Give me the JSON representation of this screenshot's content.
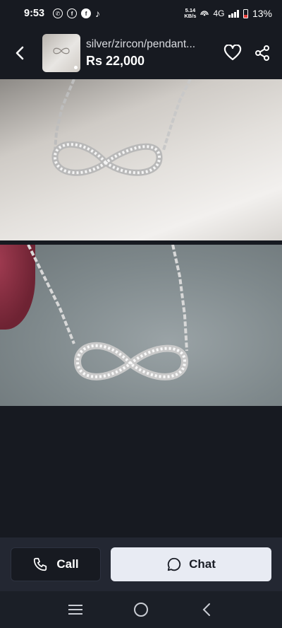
{
  "status_bar": {
    "time": "9:53",
    "net_speed_value": "5.14",
    "net_speed_unit": "KB/s",
    "network": "4G",
    "battery_percent": "13%",
    "battery_level": 0.13,
    "app_icons": [
      "whatsapp-icon",
      "facebook-icon",
      "facebook-icon",
      "tiktok-icon"
    ]
  },
  "header": {
    "title": "silver/zircon/pendant...",
    "price": "Rs 22,000",
    "icons": [
      "back-arrow-icon",
      "heart-icon",
      "share-icon"
    ]
  },
  "gallery": {
    "photos": [
      {
        "subject": "infinity-pendant-necklace"
      },
      {
        "subject": "infinity-pendant-necklace"
      }
    ]
  },
  "actions": {
    "call_label": "Call",
    "chat_label": "Chat"
  },
  "colors": {
    "background": "#171a21",
    "bottom_bar": "#232732",
    "chat_button": "#e8ebf3"
  }
}
